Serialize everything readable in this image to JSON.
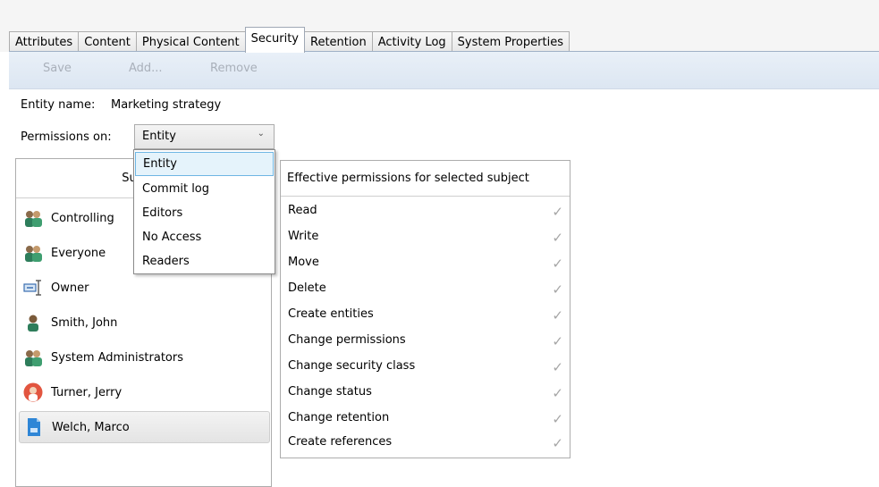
{
  "tabs": [
    {
      "label": "Attributes"
    },
    {
      "label": "Content"
    },
    {
      "label": "Physical Content"
    },
    {
      "label": "Security"
    },
    {
      "label": "Retention"
    },
    {
      "label": "Activity Log"
    },
    {
      "label": "System Properties"
    }
  ],
  "active_tab": "Security",
  "toolbar": {
    "save": "Save",
    "add": "Add...",
    "remove": "Remove"
  },
  "entity": {
    "label": "Entity name:",
    "value": "Marketing strategy"
  },
  "permissions_on": {
    "label": "Permissions on:",
    "selected": "Entity",
    "options": [
      "Entity",
      "Commit log",
      "Editors",
      "No Access",
      "Readers"
    ]
  },
  "subjects": {
    "header": "Subject",
    "items": [
      {
        "name": "Controlling",
        "icon": "group-icon"
      },
      {
        "name": "Everyone",
        "icon": "group-icon"
      },
      {
        "name": "Owner",
        "icon": "owner-icon"
      },
      {
        "name": "Smith, John",
        "icon": "user-icon"
      },
      {
        "name": "System Administrators",
        "icon": "group-icon"
      },
      {
        "name": "Turner, Jerry",
        "icon": "user-avatar-icon"
      },
      {
        "name": "Welch, Marco",
        "icon": "user-card-icon",
        "selected": true
      }
    ]
  },
  "effective": {
    "header": "Effective permissions for selected subject",
    "items": [
      {
        "label": "Read",
        "granted": "✓"
      },
      {
        "label": "Write",
        "granted": "✓"
      },
      {
        "label": "Move",
        "granted": "✓"
      },
      {
        "label": "Delete",
        "granted": "✓"
      },
      {
        "label": "Create entities",
        "granted": "✓"
      },
      {
        "label": "Change permissions",
        "granted": "✓"
      },
      {
        "label": "Change security class",
        "granted": "✓"
      },
      {
        "label": "Change status",
        "granted": "✓"
      },
      {
        "label": "Change retention",
        "granted": "✓"
      },
      {
        "label": "Create references",
        "granted": "✓"
      }
    ]
  },
  "colors": {
    "toolbar_bg": "#dce6f2",
    "dropdown_highlight": "#e5f3fb",
    "check": "#a6a6a6"
  }
}
